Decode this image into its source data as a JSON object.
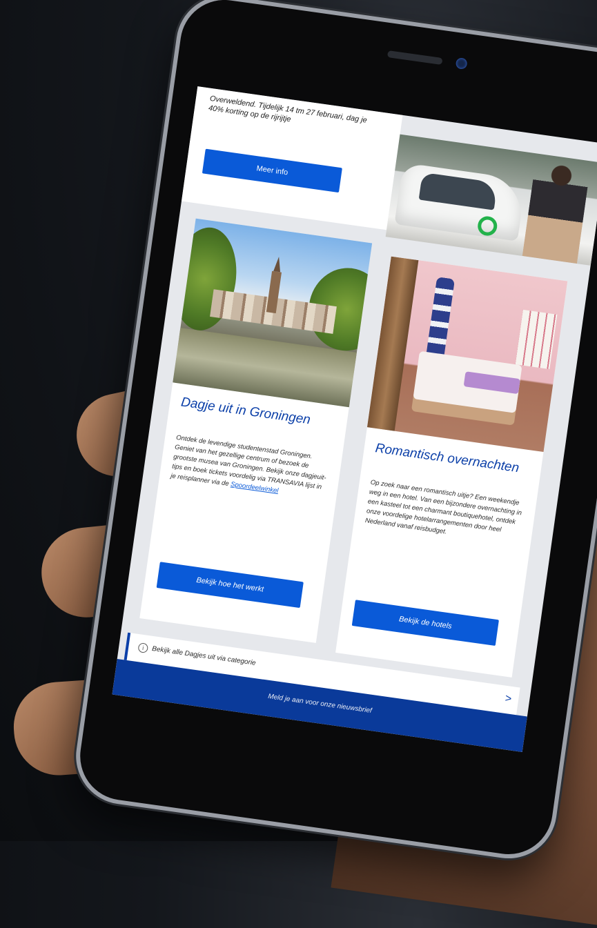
{
  "top_card": {
    "body_text": "Overweldend. Tijdelijk 14 tm 27 februari, dag je 40% korting op de rijrijtje",
    "button_label": "Meer info"
  },
  "cards": [
    {
      "title": "Dagje uit in Groningen",
      "body": "Ontdek de levendige studentenstad Groningen. Geniet van het gezellige centrum of bezoek de grootste musea van Groningen. Bekijk onze dagjeuit-tips en boek tickets voordelig via TRANSAVIA lijst in je reisplanner via de",
      "link": "Spoordeelwinkel",
      "button_label": "Bekijk hoe het werkt"
    },
    {
      "title": "Romantisch overnachten",
      "body": "Op zoek naar een romantisch uitje? Een weekendje weg in een hotel. Van een bijzondere overnachting in een kasteel tot een charmant boutiquehotel, ontdek onze voordelige hotelarrangementen door heel Nederland vanaf reisbudget.",
      "button_label": "Bekijk de hotels"
    }
  ],
  "more_link": "Bekijk alle Dagjes uit via categorie",
  "chevron": ">",
  "footer_text": "Meld je aan voor onze nieuwsbrief"
}
